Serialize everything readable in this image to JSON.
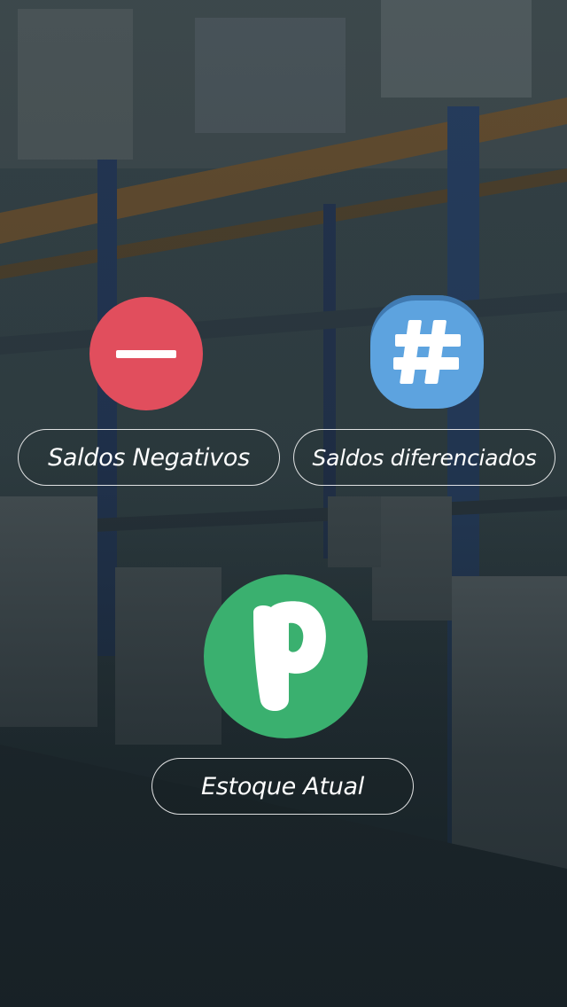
{
  "screen": {
    "background": "warehouse-shelves-photo"
  },
  "menu": {
    "negative_balances": {
      "icon": "minus-circle-icon",
      "color": "#e14e5d",
      "label": "Saldos Negativos"
    },
    "differentiated_balances": {
      "icon": "hash-icon",
      "color": "#5da3df",
      "label": "Saldos diferenciados"
    },
    "current_stock": {
      "icon": "p-logo-icon",
      "color": "#3ab06f",
      "label": "Estoque Atual"
    }
  }
}
